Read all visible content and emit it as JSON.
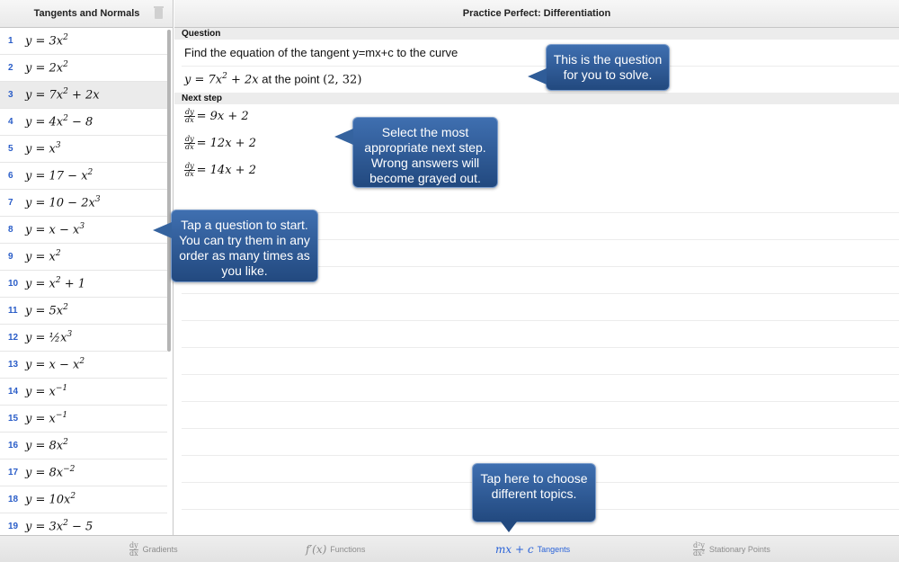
{
  "sidebar": {
    "title": "Tangents and Normals",
    "selected_index": 2,
    "items": [
      {
        "num": "1",
        "lhs": "y = 3x",
        "exp": "2",
        "rest": ""
      },
      {
        "num": "2",
        "lhs": "y = 2x",
        "exp": "2",
        "rest": ""
      },
      {
        "num": "3",
        "lhs": "y = 7x",
        "exp": "2",
        "rest": " + 2x"
      },
      {
        "num": "4",
        "lhs": "y = 4x",
        "exp": "2",
        "rest": " − 8"
      },
      {
        "num": "5",
        "lhs": "y = x",
        "exp": "3",
        "rest": ""
      },
      {
        "num": "6",
        "lhs": "y = 17 − x",
        "exp": "2",
        "rest": ""
      },
      {
        "num": "7",
        "lhs": "y = 10 − 2x",
        "exp": "3",
        "rest": ""
      },
      {
        "num": "8",
        "lhs": "y = x − x",
        "exp": "3",
        "rest": ""
      },
      {
        "num": "9",
        "lhs": "y = x",
        "exp": "2",
        "rest": ""
      },
      {
        "num": "10",
        "lhs": "y = x",
        "exp": "2",
        "rest": " + 1"
      },
      {
        "num": "11",
        "lhs": "y = 5x",
        "exp": "2",
        "rest": ""
      },
      {
        "num": "12",
        "lhs": "y = ½x",
        "exp": "3",
        "rest": ""
      },
      {
        "num": "13",
        "lhs": "y = x − x",
        "exp": "2",
        "rest": ""
      },
      {
        "num": "14",
        "lhs": "y = x",
        "exp": "−1",
        "rest": ""
      },
      {
        "num": "15",
        "lhs": "y = x",
        "exp": "−1",
        "rest": ""
      },
      {
        "num": "16",
        "lhs": "y = 8x",
        "exp": "2",
        "rest": ""
      },
      {
        "num": "17",
        "lhs": "y = 8x",
        "exp": "−2",
        "rest": ""
      },
      {
        "num": "18",
        "lhs": "y = 10x",
        "exp": "2",
        "rest": ""
      },
      {
        "num": "19",
        "lhs": "y = 3x",
        "exp": "2",
        "rest": " − 5"
      }
    ]
  },
  "header": {
    "title": "Practice Perfect: Differentiation"
  },
  "question": {
    "section_label": "Question",
    "line1": "Find the equation of the tangent y=mx+c to the curve",
    "curve_lhs": "y = 7x",
    "curve_exp": "2",
    "curve_rest": " + 2x",
    "at_text": " at the point ",
    "point": "(2, 32)"
  },
  "next_step": {
    "section_label": "Next step",
    "deriv_num": "dy",
    "deriv_den": "dx",
    "options": [
      "= 9x + 2",
      "= 12x + 2",
      "= 14x + 2"
    ]
  },
  "callouts": {
    "question": "This is the question for you to solve.",
    "next_step": "Select the most appropriate next step. Wrong answers will become grayed out.",
    "start": "Tap a question to start. You can try them in any order as many times as you like.",
    "topics": "Tap here to choose different topics."
  },
  "tabs": [
    {
      "sym": "",
      "frac_num": "dy",
      "frac_den": "dx",
      "label": "Gradients",
      "icon": "dy-dx-icon"
    },
    {
      "sym": "f′(x)",
      "frac_num": "",
      "frac_den": "",
      "label": "Functions",
      "icon": "f-prime-icon"
    },
    {
      "sym": "mx + c",
      "frac_num": "",
      "frac_den": "",
      "label": "Tangents",
      "icon": "mx-plus-c-icon"
    },
    {
      "sym": "",
      "frac_num": "d²y",
      "frac_den": "dx²",
      "label": "Stationary Points",
      "icon": "d2y-dx2-icon"
    }
  ],
  "active_tab": 2,
  "colors": {
    "accent": "#2a63d8",
    "number_blue": "#2a5dc8",
    "callout_top": "#3f6fb0",
    "callout_bottom": "#22497f",
    "selected_row": "#ebebeb"
  }
}
